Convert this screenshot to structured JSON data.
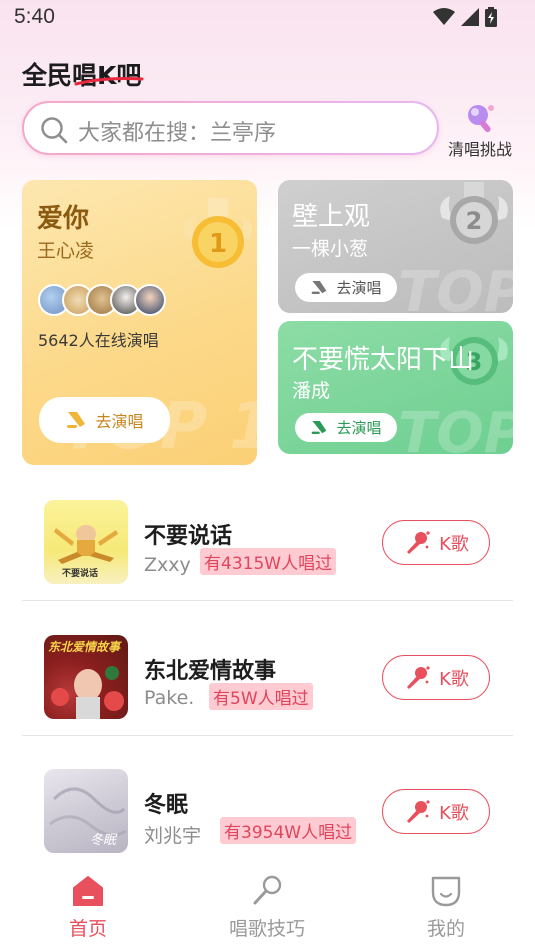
{
  "status_bar": {
    "time": "5:40"
  },
  "header": {
    "logo": "全民唱K吧",
    "search_placeholder": "大家都在搜：兰亭序",
    "challenge_label": "清唱挑战"
  },
  "top_cards": [
    {
      "rank": "1",
      "watermark": "TOP 1",
      "title": "爱你",
      "artist": "王心凌",
      "online_text": "5642人在线演唱",
      "button_label": "去演唱"
    },
    {
      "rank": "2",
      "watermark": "TOP 2",
      "title": "壁上观",
      "artist": "一棵小葱",
      "button_label": "去演唱"
    },
    {
      "rank": "3",
      "watermark": "TOP 3",
      "title": "不要慌太阳下山",
      "artist": "潘成",
      "button_label": "去演唱"
    }
  ],
  "songs": [
    {
      "title": "不要说话",
      "artist": "Zxxy",
      "count": "有4315W人唱过",
      "button": "K歌"
    },
    {
      "title": "东北爱情故事",
      "artist": "Pake.",
      "count": "有5W人唱过",
      "button": "K歌"
    },
    {
      "title": "冬眠",
      "artist": "刘兆宇",
      "count": "有3954W人唱过",
      "button": "K歌"
    }
  ],
  "covers": {
    "song1_caption": "不要说话",
    "song2_caption": "东北爱情故事",
    "song3_caption": "冬眠"
  },
  "bottom_nav": [
    {
      "label": "首页",
      "active": true
    },
    {
      "label": "唱歌技巧",
      "active": false
    },
    {
      "label": "我的",
      "active": false
    }
  ],
  "colors": {
    "accent": "#e8505d",
    "gold": "#fbd076",
    "silver": "#bcbcbc",
    "green": "#6ecf91"
  }
}
